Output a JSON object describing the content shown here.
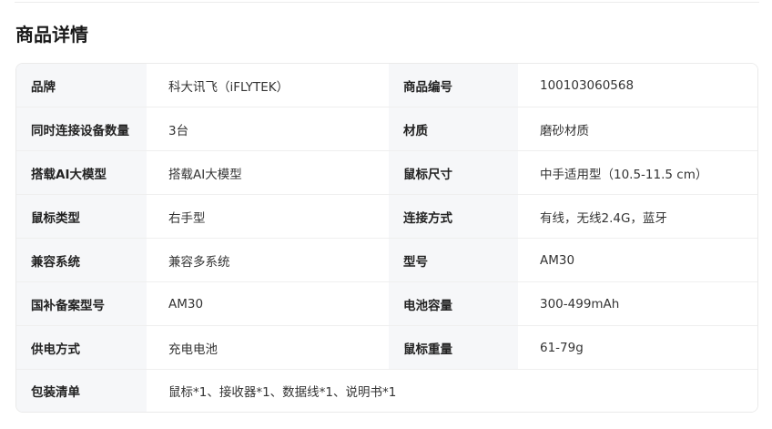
{
  "section": {
    "title": "商品详情"
  },
  "rows": [
    {
      "label1": "品牌",
      "value1": "科大讯飞（iFLYTEK）",
      "label2": "商品编号",
      "value2": "100103060568"
    },
    {
      "label1": "同时连接设备数量",
      "value1": "3台",
      "label2": "材质",
      "value2": "磨砂材质"
    },
    {
      "label1": "搭载AI大模型",
      "value1": "搭载AI大模型",
      "label2": "鼠标尺寸",
      "value2": "中手适用型（10.5-11.5 cm）"
    },
    {
      "label1": "鼠标类型",
      "value1": "右手型",
      "label2": "连接方式",
      "value2": "有线，无线2.4G，蓝牙"
    },
    {
      "label1": "兼容系统",
      "value1": "兼容多系统",
      "label2": "型号",
      "value2": "AM30"
    },
    {
      "label1": "国补备案型号",
      "value1": "AM30",
      "label2": "电池容量",
      "value2": "300-499mAh"
    },
    {
      "label1": "供电方式",
      "value1": "充电电池",
      "label2": "鼠标重量",
      "value2": "61-79g"
    }
  ],
  "package_row": {
    "label": "包装清单",
    "value": "鼠标*1、接收器*1、数据线*1、说明书*1"
  }
}
